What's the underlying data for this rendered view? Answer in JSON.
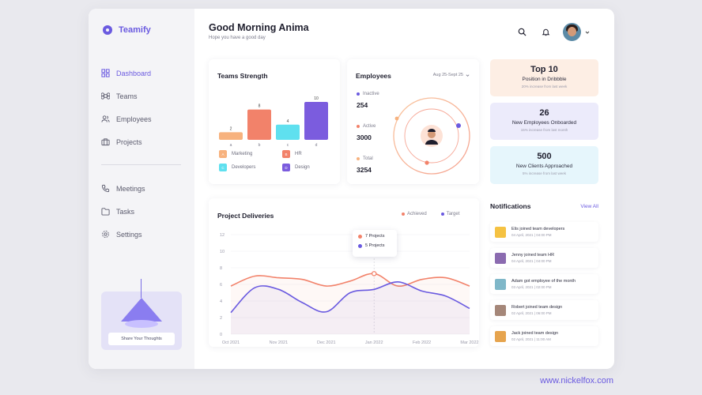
{
  "app": {
    "name": "Teamify"
  },
  "sidebar": {
    "items": [
      {
        "label": "Dashboard",
        "icon": "grid-icon",
        "active": true
      },
      {
        "label": "Teams",
        "icon": "command-icon",
        "active": false
      },
      {
        "label": "Employees",
        "icon": "users-icon",
        "active": false
      },
      {
        "label": "Projects",
        "icon": "briefcase-icon",
        "active": false
      }
    ],
    "secondary_items": [
      {
        "label": "Meetings",
        "icon": "phone-icon"
      },
      {
        "label": "Tasks",
        "icon": "folder-icon"
      },
      {
        "label": "Settings",
        "icon": "gear-icon"
      }
    ],
    "promo_button": "Share Your Thoughts"
  },
  "header": {
    "greeting": "Good Morning Anima",
    "subtitle": "Hope you have a good day"
  },
  "teams_strength": {
    "title": "Teams Strength",
    "legend": [
      {
        "letter": "A",
        "label": "Marketing",
        "color": "#f7b27e"
      },
      {
        "letter": "B",
        "label": "HR",
        "color": "#f2826a"
      },
      {
        "letter": "C",
        "label": "Developers",
        "color": "#5fe0ef"
      },
      {
        "letter": "D",
        "label": "Design",
        "color": "#7b5cde"
      }
    ]
  },
  "employees": {
    "title": "Employees",
    "date_range": "Aug 25-Sept 25",
    "stats": [
      {
        "label": "Inactive",
        "value": "254",
        "color": "#6a5ae0"
      },
      {
        "label": "Active",
        "value": "3000",
        "color": "#f2826a"
      },
      {
        "label": "Total",
        "value": "3254",
        "color": "#f7b27e"
      }
    ]
  },
  "highlights": [
    {
      "big": "Top 10",
      "label": "Position in Dribbble",
      "small": "20% increase from last week",
      "bg": "#fdeee4"
    },
    {
      "big": "26",
      "label": "New Employees Onboarded",
      "small": "15% increase from last month",
      "bg": "#ecebfb"
    },
    {
      "big": "500",
      "label": "New Clients Approached",
      "small": "5% increase from last week",
      "bg": "#e6f6fc"
    }
  ],
  "project_deliveries": {
    "title": "Project Deliveries",
    "legend_achieved": "Achieved",
    "legend_target": "Target",
    "tooltip": {
      "achieved": "7 Projects",
      "target": "5 Projects"
    }
  },
  "notifications": {
    "title": "Notifications",
    "view_all": "View All",
    "items": [
      {
        "text": "Elis joined team developers",
        "time": "04 April, 2021 | 04:00 PM",
        "color": "#f5c242"
      },
      {
        "text": "Jenny joined team HR",
        "time": "04 April, 2021 | 04:00 PM",
        "color": "#8b6bb0"
      },
      {
        "text": "Adam got employee of the month",
        "time": "03 April, 2021 | 02:00 PM",
        "color": "#7fb7c8"
      },
      {
        "text": "Robert joined team design",
        "time": "02 April, 2021 | 06:00 PM",
        "color": "#a58779"
      },
      {
        "text": "Jack joined team design",
        "time": "02 April, 2021 | 11:00 AM",
        "color": "#e6a44e"
      }
    ]
  },
  "chart_data": [
    {
      "type": "bar",
      "title": "Teams Strength",
      "categories": [
        "A",
        "B",
        "C",
        "D"
      ],
      "values": [
        2,
        8,
        4,
        10
      ],
      "data_labels": [
        "2",
        "8",
        "4",
        "10"
      ],
      "colors": [
        "#f7b27e",
        "#f2826a",
        "#5fe0ef",
        "#7b5cde"
      ]
    },
    {
      "type": "line",
      "title": "Project Deliveries",
      "categories": [
        "Oct 2021",
        "Nov 2021",
        "Dec 2021",
        "Jan 2022",
        "Feb 2022",
        "Mar 2022"
      ],
      "x": [
        0,
        0.5,
        1,
        1.5,
        2,
        2.5,
        3,
        3.5,
        4,
        4.5,
        5
      ],
      "series": [
        {
          "name": "Achieved",
          "values": [
            5.8,
            7.0,
            6.8,
            6.6,
            5.8,
            6.4,
            7.3,
            5.8,
            6.6,
            6.8,
            5.8
          ],
          "color": "#f2826a"
        },
        {
          "name": "Target",
          "values": [
            2.6,
            5.6,
            5.4,
            3.8,
            2.7,
            5.0,
            5.4,
            6.3,
            5.2,
            4.6,
            3.1
          ],
          "color": "#6a5ae0"
        }
      ],
      "y_ticks": [
        "0",
        "2",
        "4",
        "6",
        "8",
        "10",
        "12"
      ],
      "ylim": [
        0,
        12
      ],
      "grid": true
    }
  ],
  "footer": {
    "brand": "www.nickelfox.com"
  }
}
